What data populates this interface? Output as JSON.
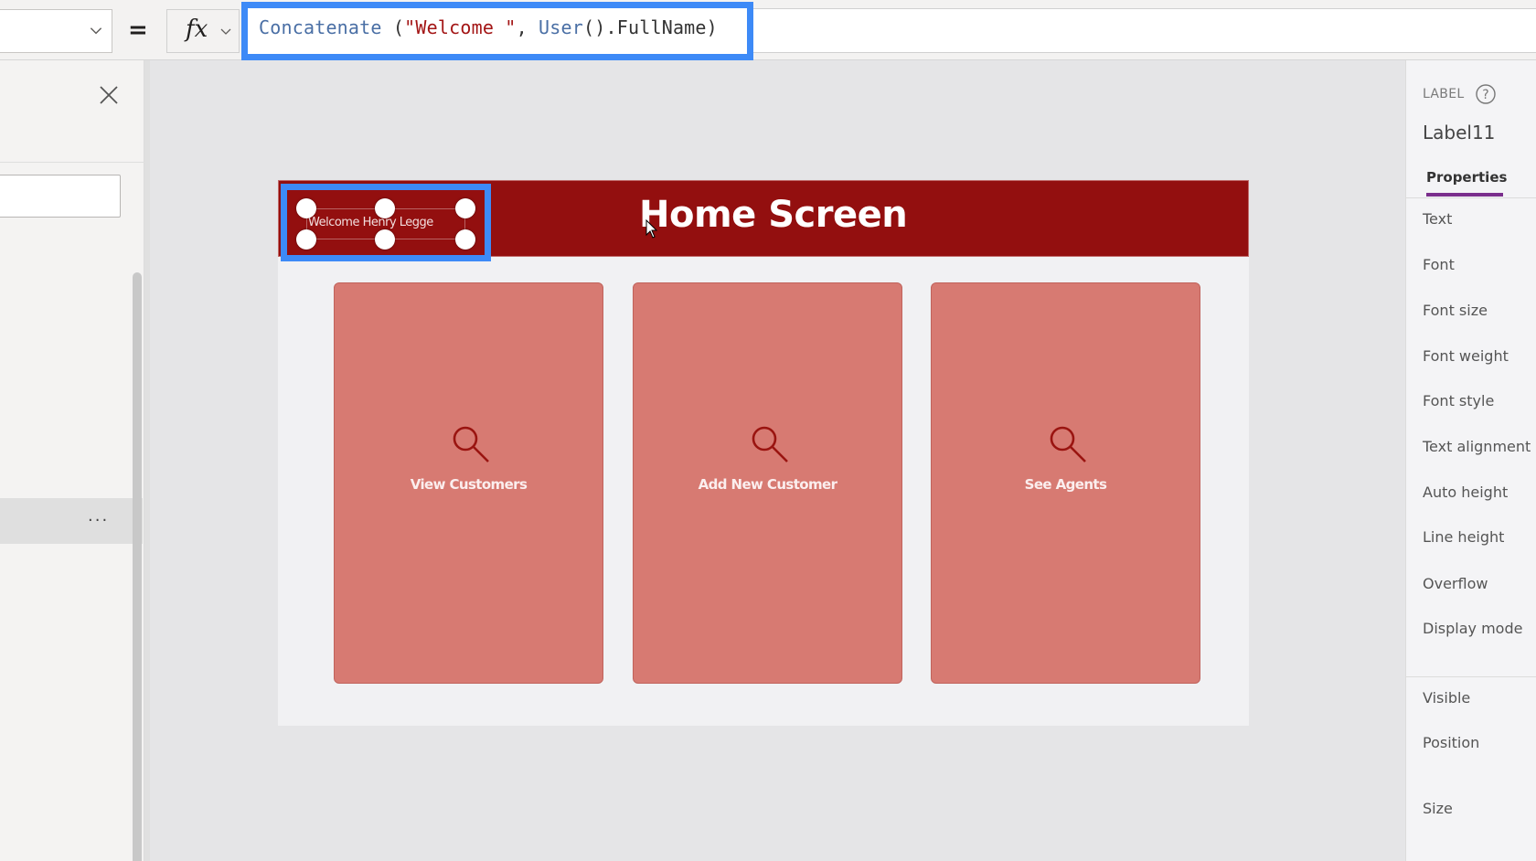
{
  "formula_bar": {
    "property_dropdown_value": "",
    "equals": "=",
    "fx_label": "fx",
    "formula": {
      "fn": "Concatenate",
      "open": " (",
      "string": "\"Welcome \"",
      "comma": ", ",
      "fn2": "User",
      "rest": "().FullName)"
    },
    "highlight_color": "#3d8af7"
  },
  "left_panel": {
    "close_icon": "close-icon",
    "more_label": "..."
  },
  "app_screen": {
    "header_title": "Home Screen",
    "header_color": "#930f0f",
    "welcome_label": "Welcome Henry Legge",
    "cards": [
      {
        "label": "View Customers",
        "icon": "search-icon"
      },
      {
        "label": "Add New Customer",
        "icon": "search-icon"
      },
      {
        "label": "See Agents",
        "icon": "search-icon"
      }
    ],
    "card_color": "#d77a72"
  },
  "right_panel": {
    "control_type": "LABEL",
    "control_name": "Label11",
    "tab": "Properties",
    "tab_accent": "#7a2e8c",
    "properties_group1": [
      "Text",
      "Font",
      "Font size",
      "Font weight",
      "Font style",
      "Text alignment",
      "Auto height",
      "Line height",
      "Overflow",
      "Display mode"
    ],
    "properties_group2": [
      "Visible",
      "Position",
      "Size"
    ]
  }
}
